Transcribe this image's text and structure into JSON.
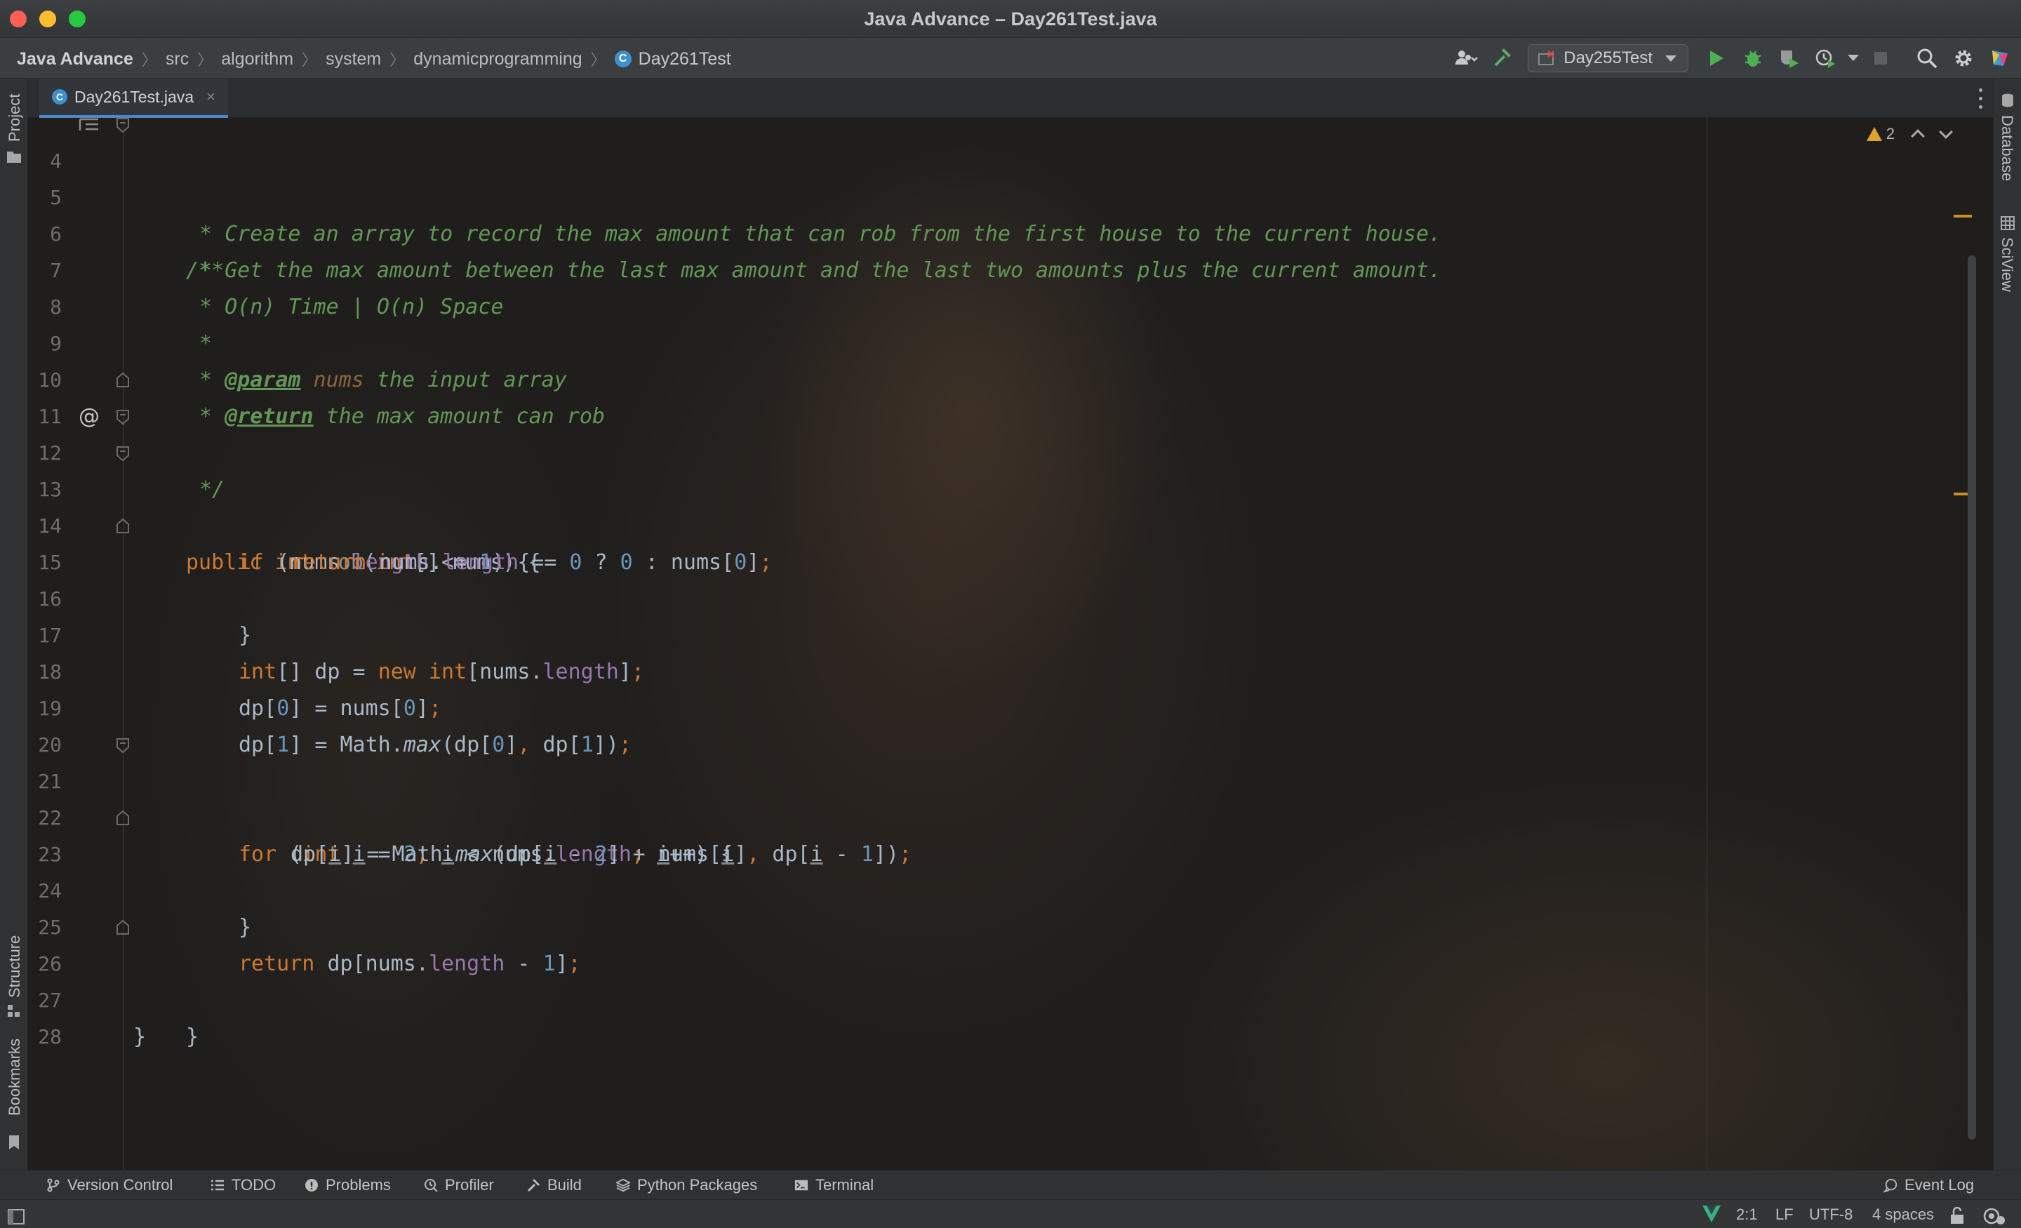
{
  "window": {
    "title": "Java Advance – Day261Test.java"
  },
  "breadcrumb": {
    "project": "Java Advance",
    "items": [
      "src",
      "algorithm",
      "system",
      "dynamicprogramming"
    ],
    "file": "Day261Test",
    "class_badge": "C"
  },
  "toolbar": {
    "run_config": "Day255Test",
    "icons": [
      "user-icon",
      "build-hammer-icon",
      "run-icon",
      "debug-icon",
      "coverage-icon",
      "profile-icon",
      "stop-icon",
      "search-icon",
      "settings-icon",
      "plugin-icon"
    ]
  },
  "tabs": [
    {
      "label": "Day261Test.java",
      "badge": "C",
      "active": true
    }
  ],
  "left_tool_tabs": {
    "top": "Project",
    "middle": "Structure",
    "bottom": "Bookmarks"
  },
  "right_tool_tabs": {
    "top": "Database",
    "bottom": "SciView"
  },
  "editor": {
    "inspection": {
      "warnings": "2"
    },
    "line_numbers": [
      "4",
      "5",
      "6",
      "7",
      "8",
      "9",
      "10",
      "11",
      "12",
      "13",
      "14",
      "15",
      "16",
      "17",
      "18",
      "19",
      "20",
      "21",
      "22",
      "23",
      "24",
      "25",
      "26",
      "27",
      "28"
    ],
    "lines": [
      "/**",
      "     * Create an array to record the max amount that can rob from the first house to the current house.",
      "     * Get the max amount between the last max amount and the last two amounts plus the current amount.",
      "     * O(n) Time | O(n) Space",
      "     *",
      "     * @param nums the input array",
      "     * @return the max amount can rob",
      "     */",
      "    public int rob(int[] nums) {",
      "        if (nums.length <= 1) {",
      "            return nums.length == 0 ? 0 : nums[0];",
      "        }",
      "",
      "        int[] dp = new int[nums.length];",
      "        dp[0] = nums[0];",
      "        dp[1] = Math.max(dp[0], dp[1]);",
      "",
      "        for (int i = 2; i < nums.length; i++) {",
      "            dp[i] = Math.max(dp[i - 2] + nums[i], dp[i - 1]);",
      "        }",
      "",
      "        return dp[nums.length - 1];",
      "    }",
      "}",
      ""
    ],
    "override_marker": "@"
  },
  "tool_windows": [
    {
      "label": "Version Control",
      "icon": "branch-icon"
    },
    {
      "label": "TODO",
      "icon": "list-icon"
    },
    {
      "label": "Problems",
      "icon": "info-circle-icon"
    },
    {
      "label": "Profiler",
      "icon": "profiler-icon"
    },
    {
      "label": "Build",
      "icon": "hammer-icon"
    },
    {
      "label": "Python Packages",
      "icon": "layers-icon"
    },
    {
      "label": "Terminal",
      "icon": "terminal-icon"
    }
  ],
  "event_log": "Event Log",
  "status": {
    "position": "2:1",
    "line_separator": "LF",
    "encoding": "UTF-8",
    "indent": "4 spaces"
  },
  "colors": {
    "keyword": "#cc7832",
    "doc_comment": "#629755",
    "number": "#6897bb",
    "field": "#9876aa",
    "plain": "#a9b7c6",
    "warning": "#e0a42a",
    "run_green": "#4caf50"
  }
}
